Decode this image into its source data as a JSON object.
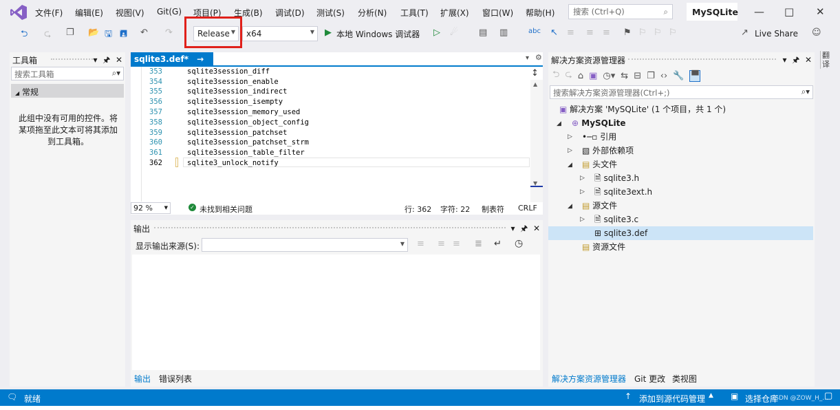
{
  "menu": [
    "文件(F)",
    "编辑(E)",
    "视图(V)",
    "Git(G)",
    "项目(P)",
    "生成(B)",
    "调试(D)",
    "测试(S)",
    "分析(N)",
    "工具(T)",
    "扩展(X)",
    "窗口(W)",
    "帮助(H)"
  ],
  "search": {
    "placeholder": "搜索 (Ctrl+Q)"
  },
  "project_name": "MySQLite",
  "toolbar": {
    "config": "Release",
    "platform": "x64",
    "run_label": "本地 Windows 调试器",
    "live_share": "Live Share"
  },
  "toolbox": {
    "title": "工具箱",
    "search_placeholder": "搜索工具箱",
    "group": "常规",
    "empty_msg": "此组中没有可用的控件。将某项拖至此文本可将其添加到工具箱。"
  },
  "editor": {
    "tab_label": "sqlite3.def*",
    "lines": [
      {
        "n": "353",
        "t": "sqlite3session_diff"
      },
      {
        "n": "354",
        "t": "sqlite3session_enable"
      },
      {
        "n": "355",
        "t": "sqlite3session_indirect"
      },
      {
        "n": "356",
        "t": "sqlite3session_isempty"
      },
      {
        "n": "357",
        "t": "sqlite3session_memory_used"
      },
      {
        "n": "358",
        "t": "sqlite3session_object_config"
      },
      {
        "n": "359",
        "t": "sqlite3session_patchset"
      },
      {
        "n": "360",
        "t": "sqlite3session_patchset_strm"
      },
      {
        "n": "361",
        "t": "sqlite3session_table_filter"
      },
      {
        "n": "362",
        "t": "sqlite3_unlock_notify"
      }
    ],
    "zoom": "92 %",
    "issues": "未找到相关问题",
    "line": "行: 362",
    "char": "字符: 22",
    "tab_mode": "制表符",
    "eol": "CRLF"
  },
  "output": {
    "title": "输出",
    "source_label": "显示输出来源(S):",
    "tabs": [
      "输出",
      "错误列表"
    ]
  },
  "solution_explorer": {
    "title": "解决方案资源管理器",
    "search_placeholder": "搜索解决方案资源管理器(Ctrl+;)",
    "solution": "解决方案 'MySQLite' (1 个项目，共 1 个)",
    "project": "MySQLite",
    "references": "引用",
    "external_deps": "外部依赖项",
    "headers": "头文件",
    "header_files": [
      "sqlite3.h",
      "sqlite3ext.h"
    ],
    "sources": "源文件",
    "source_files": [
      "sqlite3.c",
      "sqlite3.def"
    ],
    "resources": "资源文件",
    "bottom_tabs": [
      "解决方案资源管理器",
      "Git 更改",
      "类视图"
    ]
  },
  "side_strip": {
    "label": "翻译"
  },
  "statusbar": {
    "ready": "就绪",
    "add_source": "添加到源代码管理",
    "select_repo": "选择仓库",
    "watermark": "CSDN @ZOW_H_..."
  }
}
